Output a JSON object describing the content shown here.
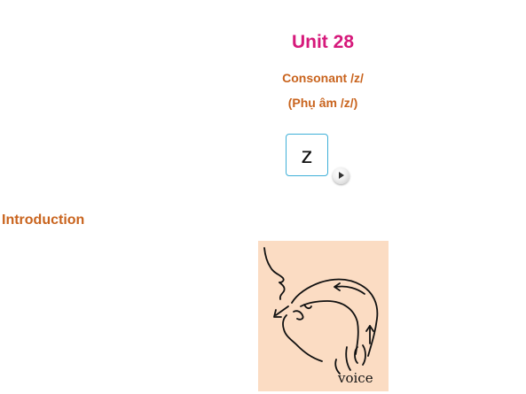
{
  "unit": {
    "title": "Unit 28",
    "subtitle_en": "Consonant /z/",
    "subtitle_vi": "(Phụ âm /z/)"
  },
  "phoneme": {
    "symbol": "z",
    "play_icon": "play-icon"
  },
  "introduction": {
    "heading": "Introduction",
    "diagram_label": "voice"
  },
  "colors": {
    "title": "#d6197b",
    "subtitle": "#c9641e",
    "heading": "#c9641e",
    "symbol_border": "#3fb0d8",
    "diagram_bg": "#fbdcc3"
  }
}
